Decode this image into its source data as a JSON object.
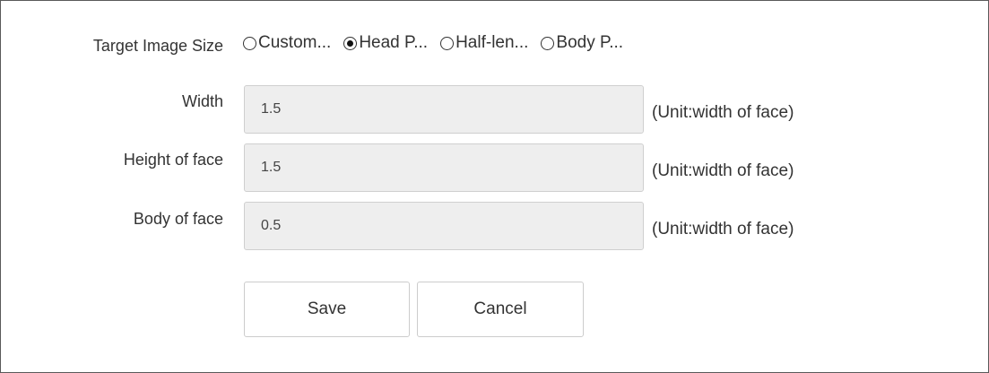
{
  "form": {
    "target_size": {
      "label": "Target Image Size",
      "options": [
        {
          "label": "Custom...",
          "checked": false
        },
        {
          "label": "Head P...",
          "checked": true
        },
        {
          "label": "Half-len...",
          "checked": false
        },
        {
          "label": "Body P...",
          "checked": false
        }
      ]
    },
    "width": {
      "label": "Width",
      "value": "1.5",
      "unit": "(Unit:width of face)"
    },
    "height_of_face": {
      "label": "Height of face",
      "value": "1.5",
      "unit": "(Unit:width of face)"
    },
    "body_of_face": {
      "label": "Body of face",
      "value": "0.5",
      "unit": "(Unit:width of face)"
    },
    "buttons": {
      "save": "Save",
      "cancel": "Cancel"
    }
  }
}
